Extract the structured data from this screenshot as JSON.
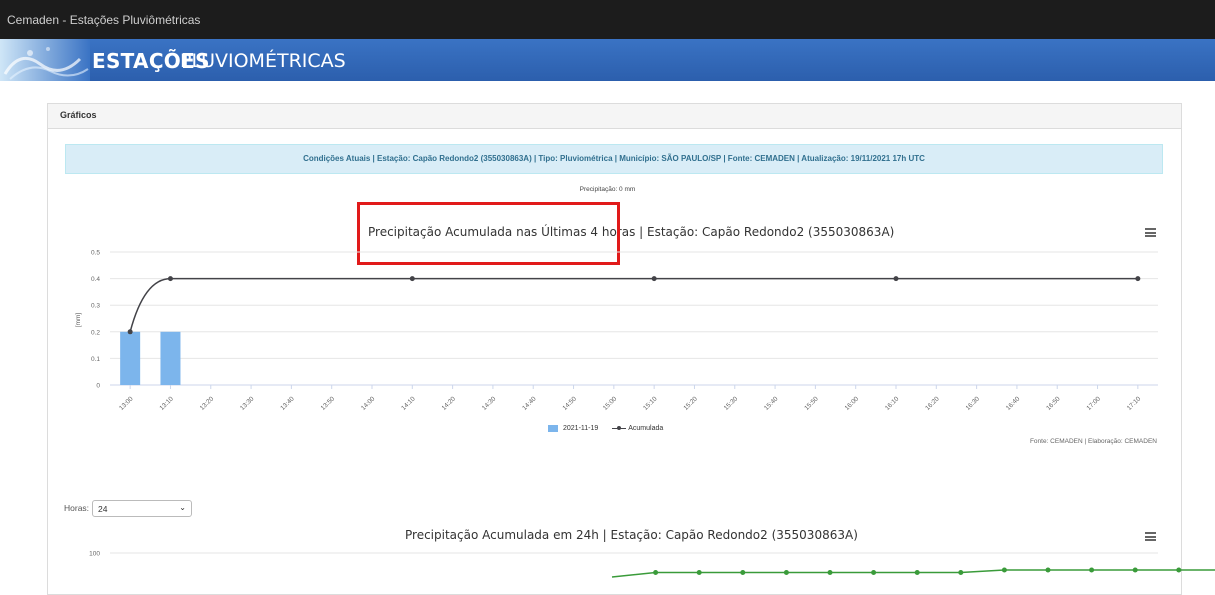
{
  "window": {
    "title": "Cemaden - Estações Pluviômétricas"
  },
  "banner": {
    "title_bold": "ESTAÇÕES",
    "title_rest": "PLUVIOMÉTRICAS"
  },
  "panel": {
    "heading": "Gráficos"
  },
  "info_bar": {
    "text": "Condições Atuais | Estação: Capão Redondo2 (355030863A) | Tipo: Pluviométrica | Município: SÃO PAULO/SP | Fonte: CEMADEN | Atualização: 19/11/2021 17h UTC"
  },
  "precip_label": "Precipitação: 0 mm",
  "chart_data": [
    {
      "type": "bar",
      "title": "Precipitação Acumulada nas Últimas 4 horas | Estação: Capão Redondo2 (355030863A)",
      "ylabel": "[mm]",
      "ylim": [
        0,
        0.5
      ],
      "yticks": [
        "0",
        "0.1",
        "0.2",
        "0.3",
        "0.4",
        "0.5"
      ],
      "categories": [
        "13:00",
        "13:10",
        "13:20",
        "13:30",
        "13:40",
        "13:50",
        "14:00",
        "14:10",
        "14:20",
        "14:30",
        "14:40",
        "14:50",
        "15:00",
        "15:10",
        "15:20",
        "15:30",
        "15:40",
        "15:50",
        "16:00",
        "16:10",
        "16:20",
        "16:30",
        "16:40",
        "16:50",
        "17:00",
        "17:10"
      ],
      "series": [
        {
          "name": "2021-11-19",
          "type": "bar",
          "color": "#7cb5ec",
          "values": [
            0.2,
            0.2,
            0,
            0,
            0,
            0,
            0,
            0,
            0,
            0,
            0,
            0,
            0,
            0,
            0,
            0,
            0,
            0,
            0,
            0,
            0,
            0,
            0,
            0,
            0,
            0
          ]
        },
        {
          "name": "Acumulada",
          "type": "line",
          "color": "#434348",
          "values": [
            0.2,
            0.4,
            0.4,
            0.4,
            0.4,
            0.4,
            0.4,
            0.4,
            0.4,
            0.4,
            0.4,
            0.4,
            0.4,
            0.4,
            0.4,
            0.4,
            0.4,
            0.4,
            0.4,
            0.4,
            0.4,
            0.4,
            0.4,
            0.4,
            0.4,
            0.4
          ],
          "markers_at": [
            "13:00",
            "13:10",
            "14:10",
            "15:10",
            "16:10",
            "17:10"
          ]
        }
      ],
      "legend": "bottom-center",
      "credit": "Fonte: CEMADEN | Elaboração: CEMADEN"
    },
    {
      "type": "line",
      "title": "Precipitação Acumulada em 24h | Estação: Capão Redondo2 (355030863A)",
      "yticks": [
        "100"
      ],
      "series": [
        {
          "color": "#3a9b3a",
          "values": [
            96,
            97,
            97,
            97,
            97,
            97,
            97,
            97,
            97,
            98,
            98,
            98,
            98,
            98,
            98
          ]
        }
      ]
    }
  ],
  "hours_control": {
    "label": "Horas:",
    "selected": "24"
  }
}
